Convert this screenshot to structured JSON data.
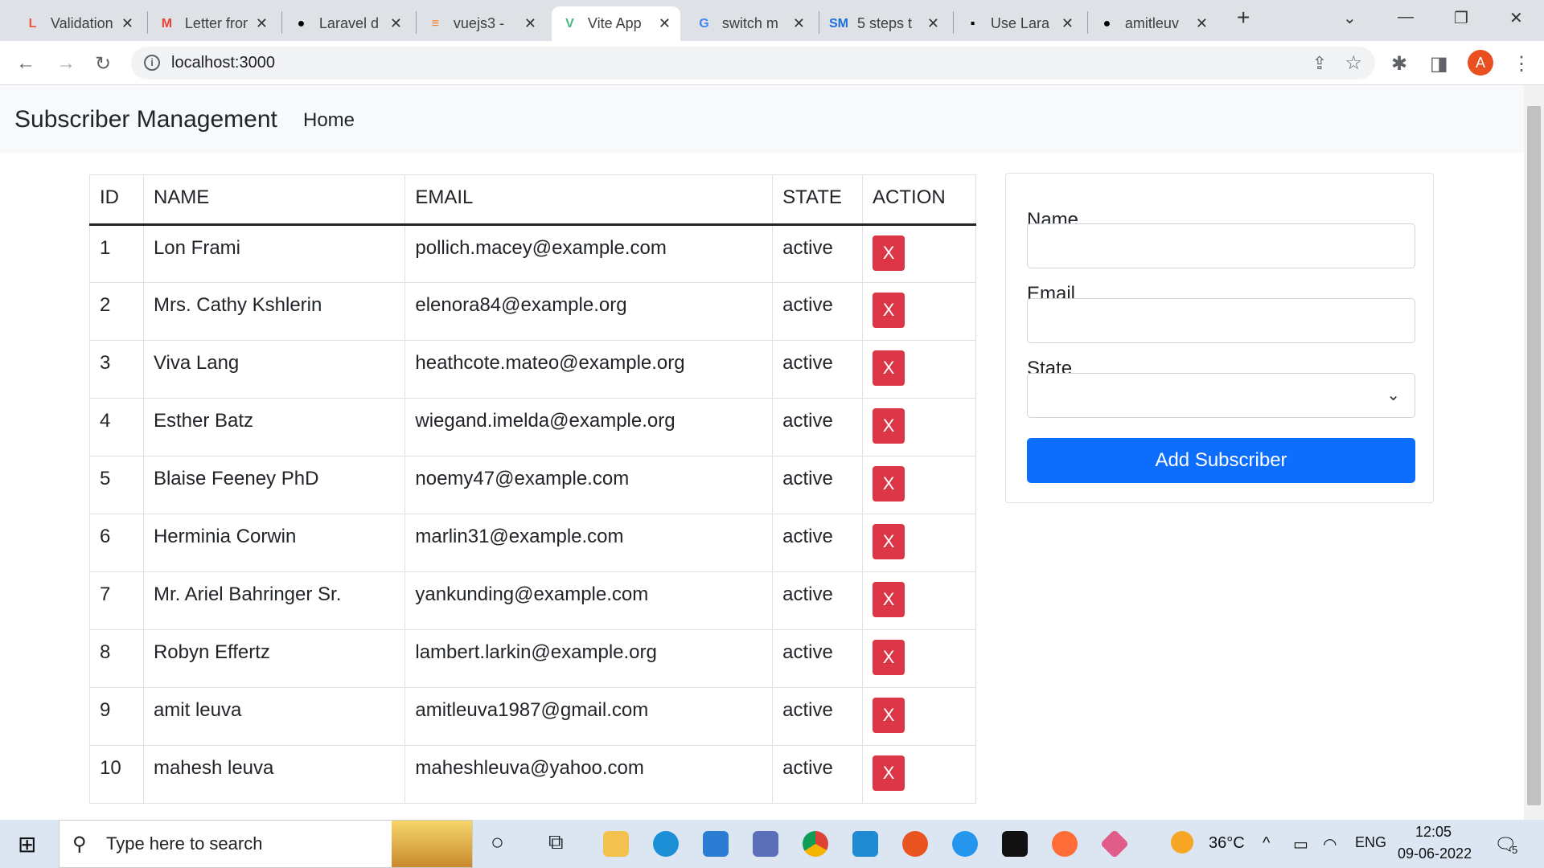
{
  "browser": {
    "tabs": [
      {
        "title": "Validation",
        "icon": "laravel-icon",
        "color": "#f05340",
        "glyph": "L"
      },
      {
        "title": "Letter from",
        "icon": "gmail-icon",
        "color": "#ea4335",
        "glyph": "M"
      },
      {
        "title": "Laravel d",
        "icon": "github-icon",
        "color": "#000000",
        "glyph": "●"
      },
      {
        "title": "vuejs3 - ",
        "icon": "stackoverflow-icon",
        "color": "#f48024",
        "glyph": "≡"
      },
      {
        "title": "Vite App",
        "icon": "vue-icon",
        "color": "#41b883",
        "glyph": "V",
        "active": true
      },
      {
        "title": "switch m",
        "icon": "google-icon",
        "color": "#4285f4",
        "glyph": "G"
      },
      {
        "title": "5 steps t",
        "icon": "sm-icon",
        "color": "#1e6fd9",
        "glyph": "SM"
      },
      {
        "title": "Use Lara",
        "icon": "build-icon",
        "color": "#000000",
        "glyph": "▪"
      },
      {
        "title": "amitleuv",
        "icon": "github-icon",
        "color": "#000000",
        "glyph": "●"
      }
    ],
    "url": "localhost:3000",
    "avatar": "A"
  },
  "navbar": {
    "brand": "Subscriber Management",
    "home": "Home"
  },
  "table": {
    "headers": [
      "ID",
      "NAME",
      "EMAIL",
      "STATE",
      "ACTION"
    ],
    "delete_label": "X",
    "rows": [
      {
        "id": "1",
        "name": "Lon Frami",
        "email": "pollich.macey@example.com",
        "state": "active"
      },
      {
        "id": "2",
        "name": "Mrs. Cathy Kshlerin",
        "email": "elenora84@example.org",
        "state": "active"
      },
      {
        "id": "3",
        "name": "Viva Lang",
        "email": "heathcote.mateo@example.org",
        "state": "active"
      },
      {
        "id": "4",
        "name": "Esther Batz",
        "email": "wiegand.imelda@example.org",
        "state": "active"
      },
      {
        "id": "5",
        "name": "Blaise Feeney PhD",
        "email": "noemy47@example.com",
        "state": "active"
      },
      {
        "id": "6",
        "name": "Herminia Corwin",
        "email": "marlin31@example.com",
        "state": "active"
      },
      {
        "id": "7",
        "name": "Mr. Ariel Bahringer Sr.",
        "email": "yankunding@example.com",
        "state": "active"
      },
      {
        "id": "8",
        "name": "Robyn Effertz",
        "email": "lambert.larkin@example.org",
        "state": "active"
      },
      {
        "id": "9",
        "name": "amit leuva",
        "email": "amitleuva1987@gmail.com",
        "state": "active"
      },
      {
        "id": "10",
        "name": "mahesh leuva",
        "email": "maheshleuva@yahoo.com",
        "state": "active"
      }
    ]
  },
  "form": {
    "name_label": "Name",
    "name_value": "",
    "email_label": "Email",
    "email_value": "",
    "state_label": "State",
    "state_value": "",
    "submit": "Add Subscriber"
  },
  "taskbar": {
    "search_placeholder": "Type here to search",
    "weather": "36°C",
    "lang": "ENG",
    "time": "12:05",
    "date": "09-06-2022",
    "notifications": "5"
  }
}
